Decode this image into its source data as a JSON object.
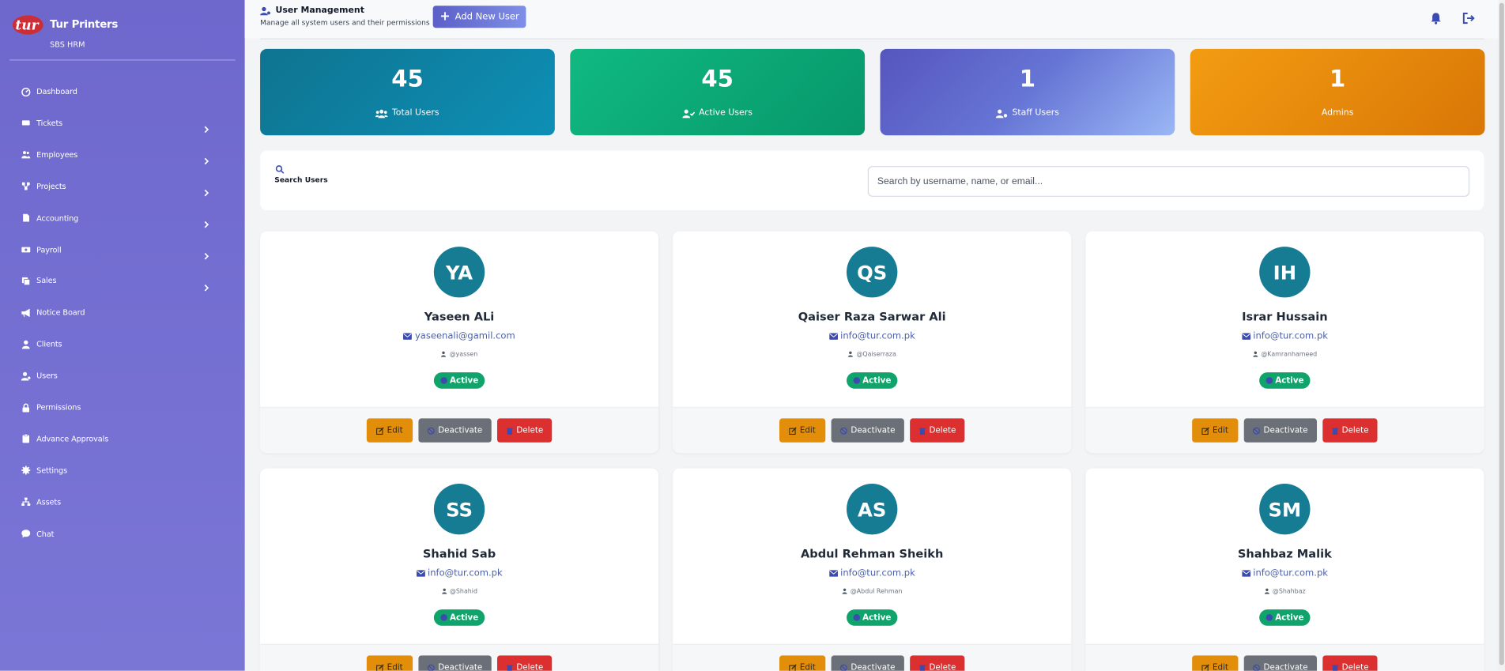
{
  "brand": {
    "name": "Tur Printers",
    "sub": "SBS HRM",
    "logo_text": "tur"
  },
  "sidebar": {
    "items": [
      {
        "label": "Dashboard",
        "icon": "dashboard-icon",
        "has_chevron": false
      },
      {
        "label": "Tickets",
        "icon": "ticket-icon",
        "has_chevron": true
      },
      {
        "label": "Employees",
        "icon": "users-icon",
        "has_chevron": true
      },
      {
        "label": "Projects",
        "icon": "project-icon",
        "has_chevron": true
      },
      {
        "label": "Accounting",
        "icon": "file-icon",
        "has_chevron": true
      },
      {
        "label": "Payroll",
        "icon": "money-icon",
        "has_chevron": true
      },
      {
        "label": "Sales",
        "icon": "sales-icon",
        "has_chevron": true
      },
      {
        "label": "Notice Board",
        "icon": "megaphone-icon",
        "has_chevron": false
      },
      {
        "label": "Clients",
        "icon": "user-icon",
        "has_chevron": false
      },
      {
        "label": "Users",
        "icon": "user-cog-icon",
        "has_chevron": false
      },
      {
        "label": "Permissions",
        "icon": "lock-icon",
        "has_chevron": false
      },
      {
        "label": "Advance Approvals",
        "icon": "clipboard-icon",
        "has_chevron": false
      },
      {
        "label": "Settings",
        "icon": "gear-icon",
        "has_chevron": false
      },
      {
        "label": "Assets",
        "icon": "sitemap-icon",
        "has_chevron": false
      },
      {
        "label": "Chat",
        "icon": "chat-icon",
        "has_chevron": false
      }
    ]
  },
  "header": {
    "title": "User Management",
    "subtitle": "Manage all system users and their permissions",
    "add_button": "Add New User"
  },
  "stats": [
    {
      "value": "45",
      "label": "Total Users"
    },
    {
      "value": "45",
      "label": "Active Users"
    },
    {
      "value": "1",
      "label": "Staff Users"
    },
    {
      "value": "1",
      "label": "Admins"
    }
  ],
  "search": {
    "label": "Search Users",
    "placeholder": "Search by username, name, or email..."
  },
  "users": [
    {
      "initials": "YA",
      "name": "Yaseen ALi",
      "email": "yaseenali@gamil.com",
      "username": "@yassen",
      "status": "Active"
    },
    {
      "initials": "QS",
      "name": "Qaiser Raza Sarwar Ali",
      "email": "info@tur.com.pk",
      "username": "@Qaiserraza",
      "status": "Active"
    },
    {
      "initials": "IH",
      "name": "Israr Hussain",
      "email": "info@tur.com.pk",
      "username": "@Kamranhameed",
      "status": "Active"
    },
    {
      "initials": "SS",
      "name": "Shahid Sab",
      "email": "info@tur.com.pk",
      "username": "@Shahid",
      "status": "Active"
    },
    {
      "initials": "AS",
      "name": "Abdul Rehman Sheikh",
      "email": "info@tur.com.pk",
      "username": "@Abdul Rehman",
      "status": "Active"
    },
    {
      "initials": "SM",
      "name": "Shahbaz Malik",
      "email": "info@tur.com.pk",
      "username": "@Shahbaz",
      "status": "Active"
    }
  ],
  "card_actions": {
    "edit": "Edit",
    "deactivate": "Deactivate",
    "delete": "Delete"
  },
  "colors": {
    "sidebar": "#7370d2",
    "total_users": "#0e7fa3",
    "active_users": "#0fa876",
    "staff_users": "#6f7fdc",
    "admins": "#e58a0c",
    "avatar": "#167c93",
    "badge_active": "#10a36b",
    "edit": "#e28e0b",
    "deactivate": "#6b7078",
    "delete": "#dc2f2f"
  }
}
